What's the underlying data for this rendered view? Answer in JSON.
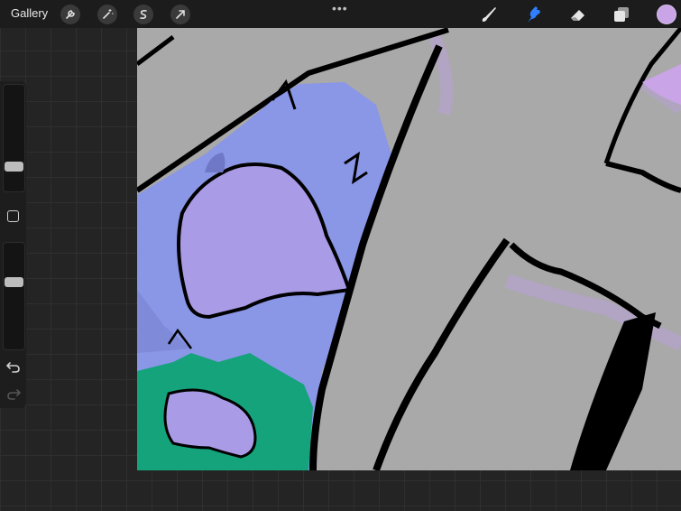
{
  "topbar": {
    "gallery_label": "Gallery",
    "left_tools": [
      "wrench-icon",
      "magic-wand-icon",
      "selection-icon",
      "transform-arrow-icon"
    ],
    "more_label": "•••",
    "right_tools": [
      "brush-icon",
      "smudge-icon",
      "eraser-icon",
      "layers-icon"
    ],
    "active_tool": "smudge-icon",
    "active_color": "#c9a4e6",
    "accent": "#2f7fff"
  },
  "sidebar": {
    "brush_size_level": 0.21,
    "opacity_level": 0.36
  },
  "canvas": {
    "colors": {
      "background": "#a9a9a9",
      "fur": "#8a96e6",
      "ear_inner": "#a99be6",
      "shirt": "#14a37b",
      "glow": "#c9a4e6",
      "line": "#000000"
    }
  }
}
